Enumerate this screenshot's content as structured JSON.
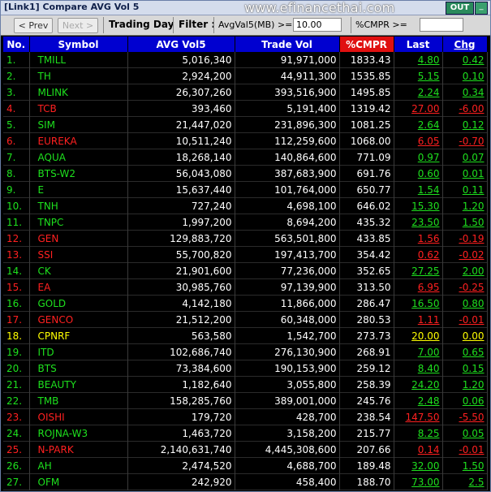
{
  "window": {
    "title": "[Link1] Compare AVG Vol 5",
    "watermark": "www.efinancethai.com",
    "out_label": "OUT",
    "min_label": "_"
  },
  "toolbar": {
    "prev_label": "< Prev",
    "next_label": "Next >",
    "trading_day_label": "Trading Day",
    "filter_label": "Filter :",
    "avgvol_label": "AvgVal5(MB) >=",
    "avgvol_value": "10.00",
    "cmpr_label": "%CMPR >=",
    "cmpr_value": ""
  },
  "colors": {
    "up": "#1ee01e",
    "down": "#ff2020",
    "flat": "#ffff00",
    "header_bg": "#0000d0",
    "cmpr_header_bg": "#e01010"
  },
  "table": {
    "headers": [
      "No.",
      "Symbol",
      "AVG Vol5",
      "Trade Vol",
      "%CMPR",
      "Last",
      "Chg"
    ],
    "rows": [
      {
        "no": "1.",
        "symbol": "TMILL",
        "avg": "5,016,340",
        "trade": "91,971,000",
        "cmpr": "1833.43",
        "last": "4.80",
        "chg": "0.42",
        "dir": "up"
      },
      {
        "no": "2.",
        "symbol": "TH",
        "avg": "2,924,200",
        "trade": "44,911,300",
        "cmpr": "1535.85",
        "last": "5.15",
        "chg": "0.10",
        "dir": "up"
      },
      {
        "no": "3.",
        "symbol": "MLINK",
        "avg": "26,307,260",
        "trade": "393,516,900",
        "cmpr": "1495.85",
        "last": "2.24",
        "chg": "0.34",
        "dir": "up"
      },
      {
        "no": "4.",
        "symbol": "TCB",
        "avg": "393,460",
        "trade": "5,191,400",
        "cmpr": "1319.42",
        "last": "27.00",
        "chg": "-6.00",
        "dir": "down"
      },
      {
        "no": "5.",
        "symbol": "SIM",
        "avg": "21,447,020",
        "trade": "231,896,300",
        "cmpr": "1081.25",
        "last": "2.64",
        "chg": "0.12",
        "dir": "up"
      },
      {
        "no": "6.",
        "symbol": "EUREKA",
        "avg": "10,511,240",
        "trade": "112,259,600",
        "cmpr": "1068.00",
        "last": "6.05",
        "chg": "-0.70",
        "dir": "down"
      },
      {
        "no": "7.",
        "symbol": "AQUA",
        "avg": "18,268,140",
        "trade": "140,864,600",
        "cmpr": "771.09",
        "last": "0.97",
        "chg": "0.07",
        "dir": "up"
      },
      {
        "no": "8.",
        "symbol": "BTS-W2",
        "avg": "56,043,080",
        "trade": "387,683,900",
        "cmpr": "691.76",
        "last": "0.60",
        "chg": "0.01",
        "dir": "up"
      },
      {
        "no": "9.",
        "symbol": "E",
        "avg": "15,637,440",
        "trade": "101,764,000",
        "cmpr": "650.77",
        "last": "1.54",
        "chg": "0.11",
        "dir": "up"
      },
      {
        "no": "10.",
        "symbol": "TNH",
        "avg": "727,240",
        "trade": "4,698,100",
        "cmpr": "646.02",
        "last": "15.30",
        "chg": "1.20",
        "dir": "up"
      },
      {
        "no": "11.",
        "symbol": "TNPC",
        "avg": "1,997,200",
        "trade": "8,694,200",
        "cmpr": "435.32",
        "last": "23.50",
        "chg": "1.50",
        "dir": "up"
      },
      {
        "no": "12.",
        "symbol": "GEN",
        "avg": "129,883,720",
        "trade": "563,501,800",
        "cmpr": "433.85",
        "last": "1.56",
        "chg": "-0.19",
        "dir": "down"
      },
      {
        "no": "13.",
        "symbol": "SSI",
        "avg": "55,700,820",
        "trade": "197,413,700",
        "cmpr": "354.42",
        "last": "0.62",
        "chg": "-0.02",
        "dir": "down"
      },
      {
        "no": "14.",
        "symbol": "CK",
        "avg": "21,901,600",
        "trade": "77,236,000",
        "cmpr": "352.65",
        "last": "27.25",
        "chg": "2.00",
        "dir": "up"
      },
      {
        "no": "15.",
        "symbol": "EA",
        "avg": "30,985,760",
        "trade": "97,139,900",
        "cmpr": "313.50",
        "last": "6.95",
        "chg": "-0.25",
        "dir": "down"
      },
      {
        "no": "16.",
        "symbol": "GOLD",
        "avg": "4,142,180",
        "trade": "11,866,000",
        "cmpr": "286.47",
        "last": "16.50",
        "chg": "0.80",
        "dir": "up"
      },
      {
        "no": "17.",
        "symbol": "GENCO",
        "avg": "21,512,200",
        "trade": "60,348,000",
        "cmpr": "280.53",
        "last": "1.11",
        "chg": "-0.01",
        "dir": "down"
      },
      {
        "no": "18.",
        "symbol": "CPNRF",
        "avg": "563,580",
        "trade": "1,542,700",
        "cmpr": "273.73",
        "last": "20.00",
        "chg": "0.00",
        "dir": "flat"
      },
      {
        "no": "19.",
        "symbol": "ITD",
        "avg": "102,686,740",
        "trade": "276,130,900",
        "cmpr": "268.91",
        "last": "7.00",
        "chg": "0.65",
        "dir": "up"
      },
      {
        "no": "20.",
        "symbol": "BTS",
        "avg": "73,384,600",
        "trade": "190,153,900",
        "cmpr": "259.12",
        "last": "8.40",
        "chg": "0.15",
        "dir": "up"
      },
      {
        "no": "21.",
        "symbol": "BEAUTY",
        "avg": "1,182,640",
        "trade": "3,055,800",
        "cmpr": "258.39",
        "last": "24.20",
        "chg": "1.20",
        "dir": "up"
      },
      {
        "no": "22.",
        "symbol": "TMB",
        "avg": "158,285,760",
        "trade": "389,001,000",
        "cmpr": "245.76",
        "last": "2.48",
        "chg": "0.06",
        "dir": "up"
      },
      {
        "no": "23.",
        "symbol": "OISHI",
        "avg": "179,720",
        "trade": "428,700",
        "cmpr": "238.54",
        "last": "147.50",
        "chg": "-5.50",
        "dir": "down"
      },
      {
        "no": "24.",
        "symbol": "ROJNA-W3",
        "avg": "1,463,720",
        "trade": "3,158,200",
        "cmpr": "215.77",
        "last": "8.25",
        "chg": "0.05",
        "dir": "up"
      },
      {
        "no": "25.",
        "symbol": "N-PARK",
        "avg": "2,140,631,740",
        "trade": "4,445,308,600",
        "cmpr": "207.66",
        "last": "0.14",
        "chg": "-0.01",
        "dir": "down"
      },
      {
        "no": "26.",
        "symbol": "AH",
        "avg": "2,474,520",
        "trade": "4,688,700",
        "cmpr": "189.48",
        "last": "32.00",
        "chg": "1.50",
        "dir": "up"
      },
      {
        "no": "27.",
        "symbol": "OFM",
        "avg": "242,920",
        "trade": "458,400",
        "cmpr": "188.70",
        "last": "73.00",
        "chg": "2.5",
        "dir": "up"
      }
    ]
  }
}
